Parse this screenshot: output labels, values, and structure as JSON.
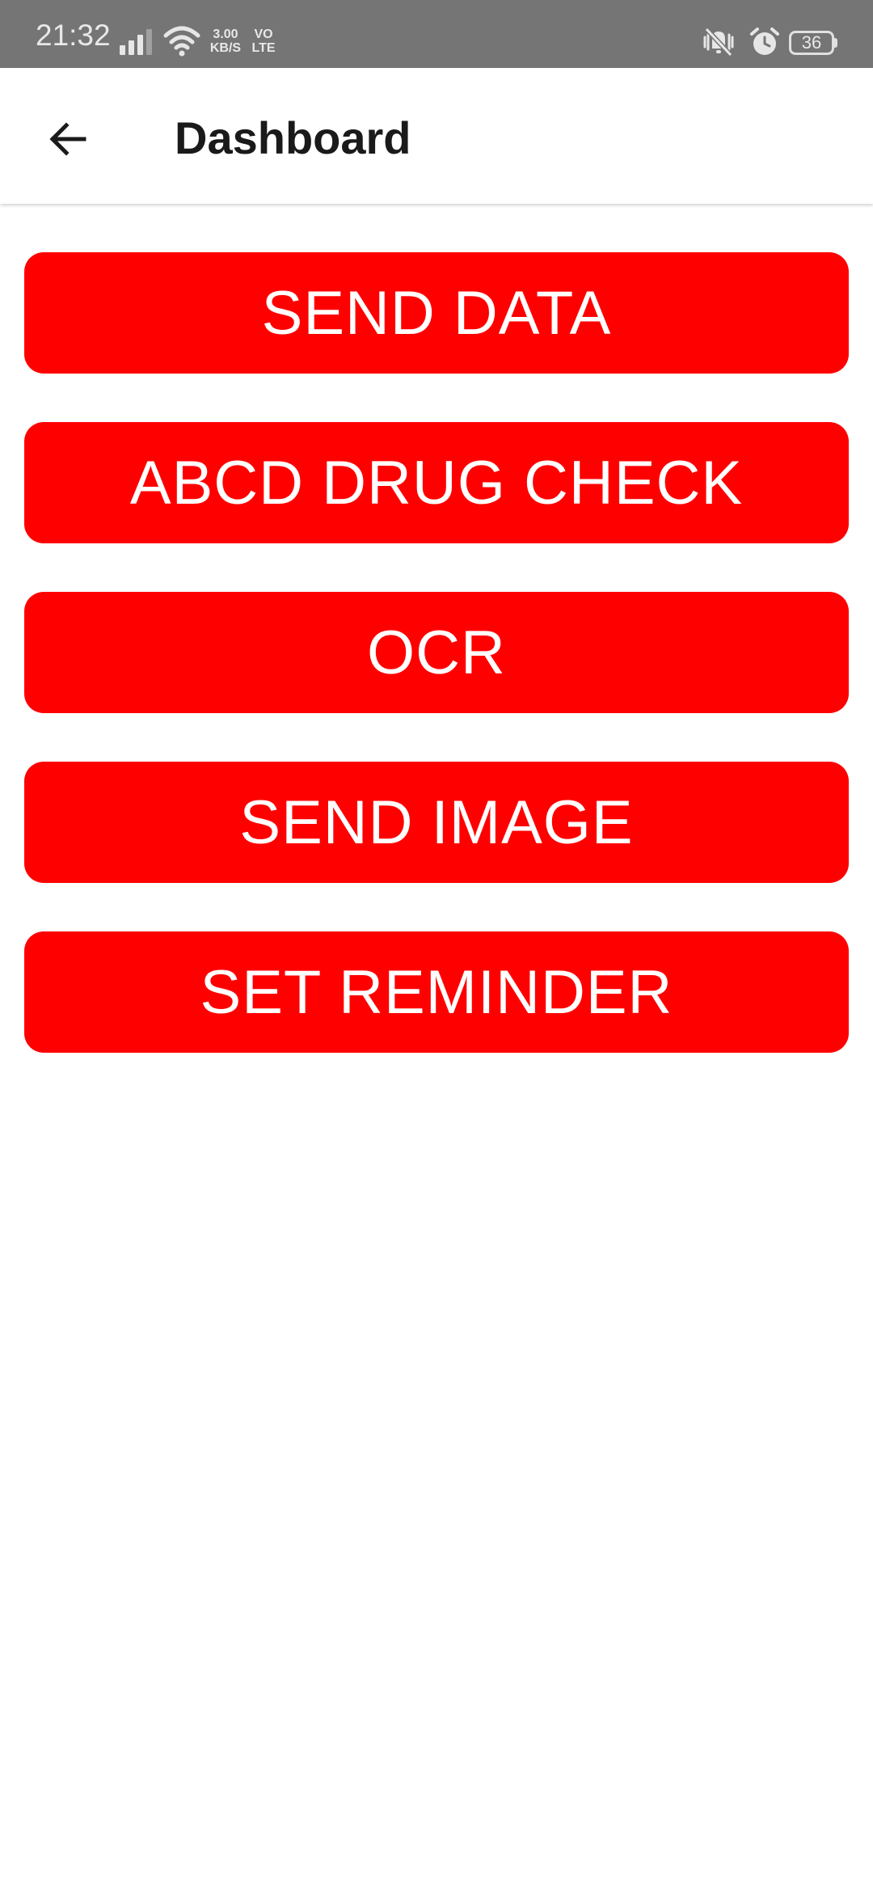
{
  "status_bar": {
    "time": "21:32",
    "speed_value": "3.00",
    "speed_unit": "KB/S",
    "volte_top": "VO",
    "volte_bottom": "LTE",
    "battery": "36",
    "icons": [
      "signal-icon",
      "wifi-icon",
      "mute-vibrate-icon",
      "alarm-icon",
      "battery-icon"
    ]
  },
  "app_bar": {
    "back_icon": "arrow-left-icon",
    "title": "Dashboard"
  },
  "actions": [
    {
      "label": "SEND DATA"
    },
    {
      "label": "ABCD DRUG CHECK"
    },
    {
      "label": "OCR"
    },
    {
      "label": "SEND IMAGE"
    },
    {
      "label": "SET REMINDER"
    }
  ],
  "colors": {
    "button_bg": "#ff0000",
    "button_text": "#ffffff",
    "status_bar_bg": "#757575"
  }
}
